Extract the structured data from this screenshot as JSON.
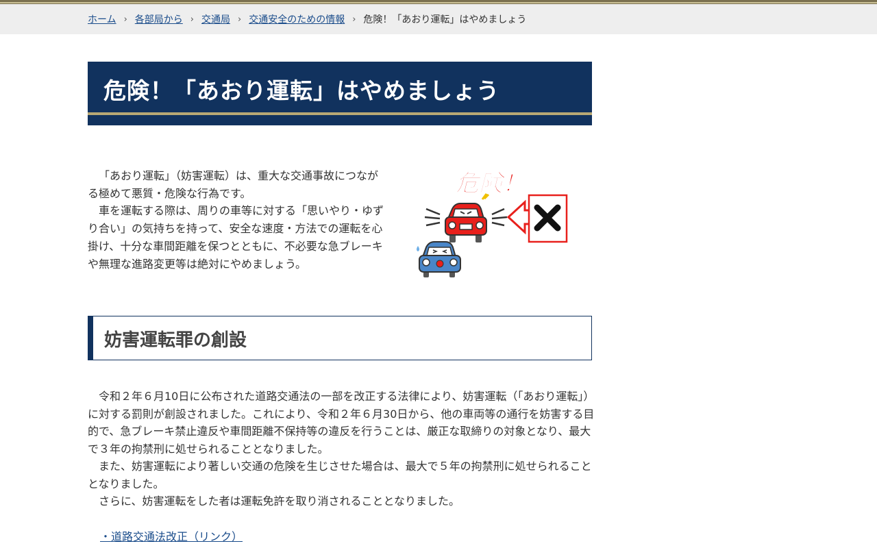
{
  "breadcrumb": {
    "items": [
      "ホーム",
      "各部局から",
      "交通局",
      "交通安全のための情報"
    ],
    "current": "危険！「あおり運転」はやめましょう"
  },
  "page_title": "危険！「あおり運転」はやめましょう",
  "intro": {
    "paragraph1": "「あおり運転」（妨害運転）は、重大な交通事故につながる極めて悪質・危険な行為です。",
    "paragraph2": "車を運転する際は、周りの車等に対する「思いやり・ゆずり合い」の気持ちを持って、安全な速度・方法での運転を心掛け、十分な車間距離を保つとともに、不必要な急ブレーキや無理な進路変更等は絶対にやめましょう。"
  },
  "illustration": {
    "caption": "危険！",
    "icons": [
      "red-car-icon",
      "blue-car-icon",
      "cross-mark-icon",
      "arrow-icon"
    ]
  },
  "section": {
    "heading": "妨害運転罪の創設",
    "paragraph1": "令和２年６月10日に公布された道路交通法の一部を改正する法律により、妨害運転（「あおり運転」）に対する罰則が創設されました。これにより、令和２年６月30日から、他の車両等の通行を妨害する目的で、急ブレーキ禁止違反や車間距離不保持等の違反を行うことは、厳正な取締りの対象となり、最大で３年の拘禁刑に処せられることとなりました。",
    "paragraph2": "また、妨害運転により著しい交通の危険を生じさせた場合は、最大で５年の拘禁刑に処せられることとなりました。",
    "paragraph3": "さらに、妨害運転をした者は運転免許を取り消されることとなりました。",
    "link": "・道路交通法改正（リンク）"
  },
  "colors": {
    "navy": "#11325e",
    "gold": "#b8a874",
    "link": "#1a4c8b",
    "danger_red": "#e8201c"
  }
}
